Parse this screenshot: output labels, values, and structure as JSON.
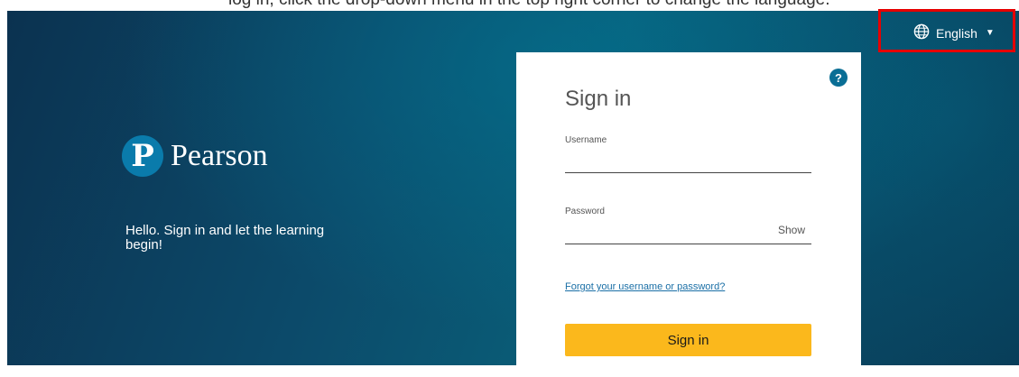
{
  "caption": {
    "text": "log in, click the drop-down menu in the top right corner to change the language."
  },
  "language_selector": {
    "label": "English",
    "icon": "globe-icon",
    "caret": "▼"
  },
  "brand": {
    "logo_letter": "P",
    "name": "Pearson",
    "logo_color": "#0a7bab"
  },
  "tagline": "Hello. Sign in and let the learning begin!",
  "signin_card": {
    "title": "Sign in",
    "help_icon": "?",
    "username": {
      "label": "Username",
      "value": ""
    },
    "password": {
      "label": "Password",
      "value": "",
      "show_label": "Show"
    },
    "forgot_link": "Forgot your username or password?",
    "submit_label": "Sign in",
    "submit_color": "#fbb81c"
  },
  "annotation": {
    "highlight_color": "#e60000"
  }
}
